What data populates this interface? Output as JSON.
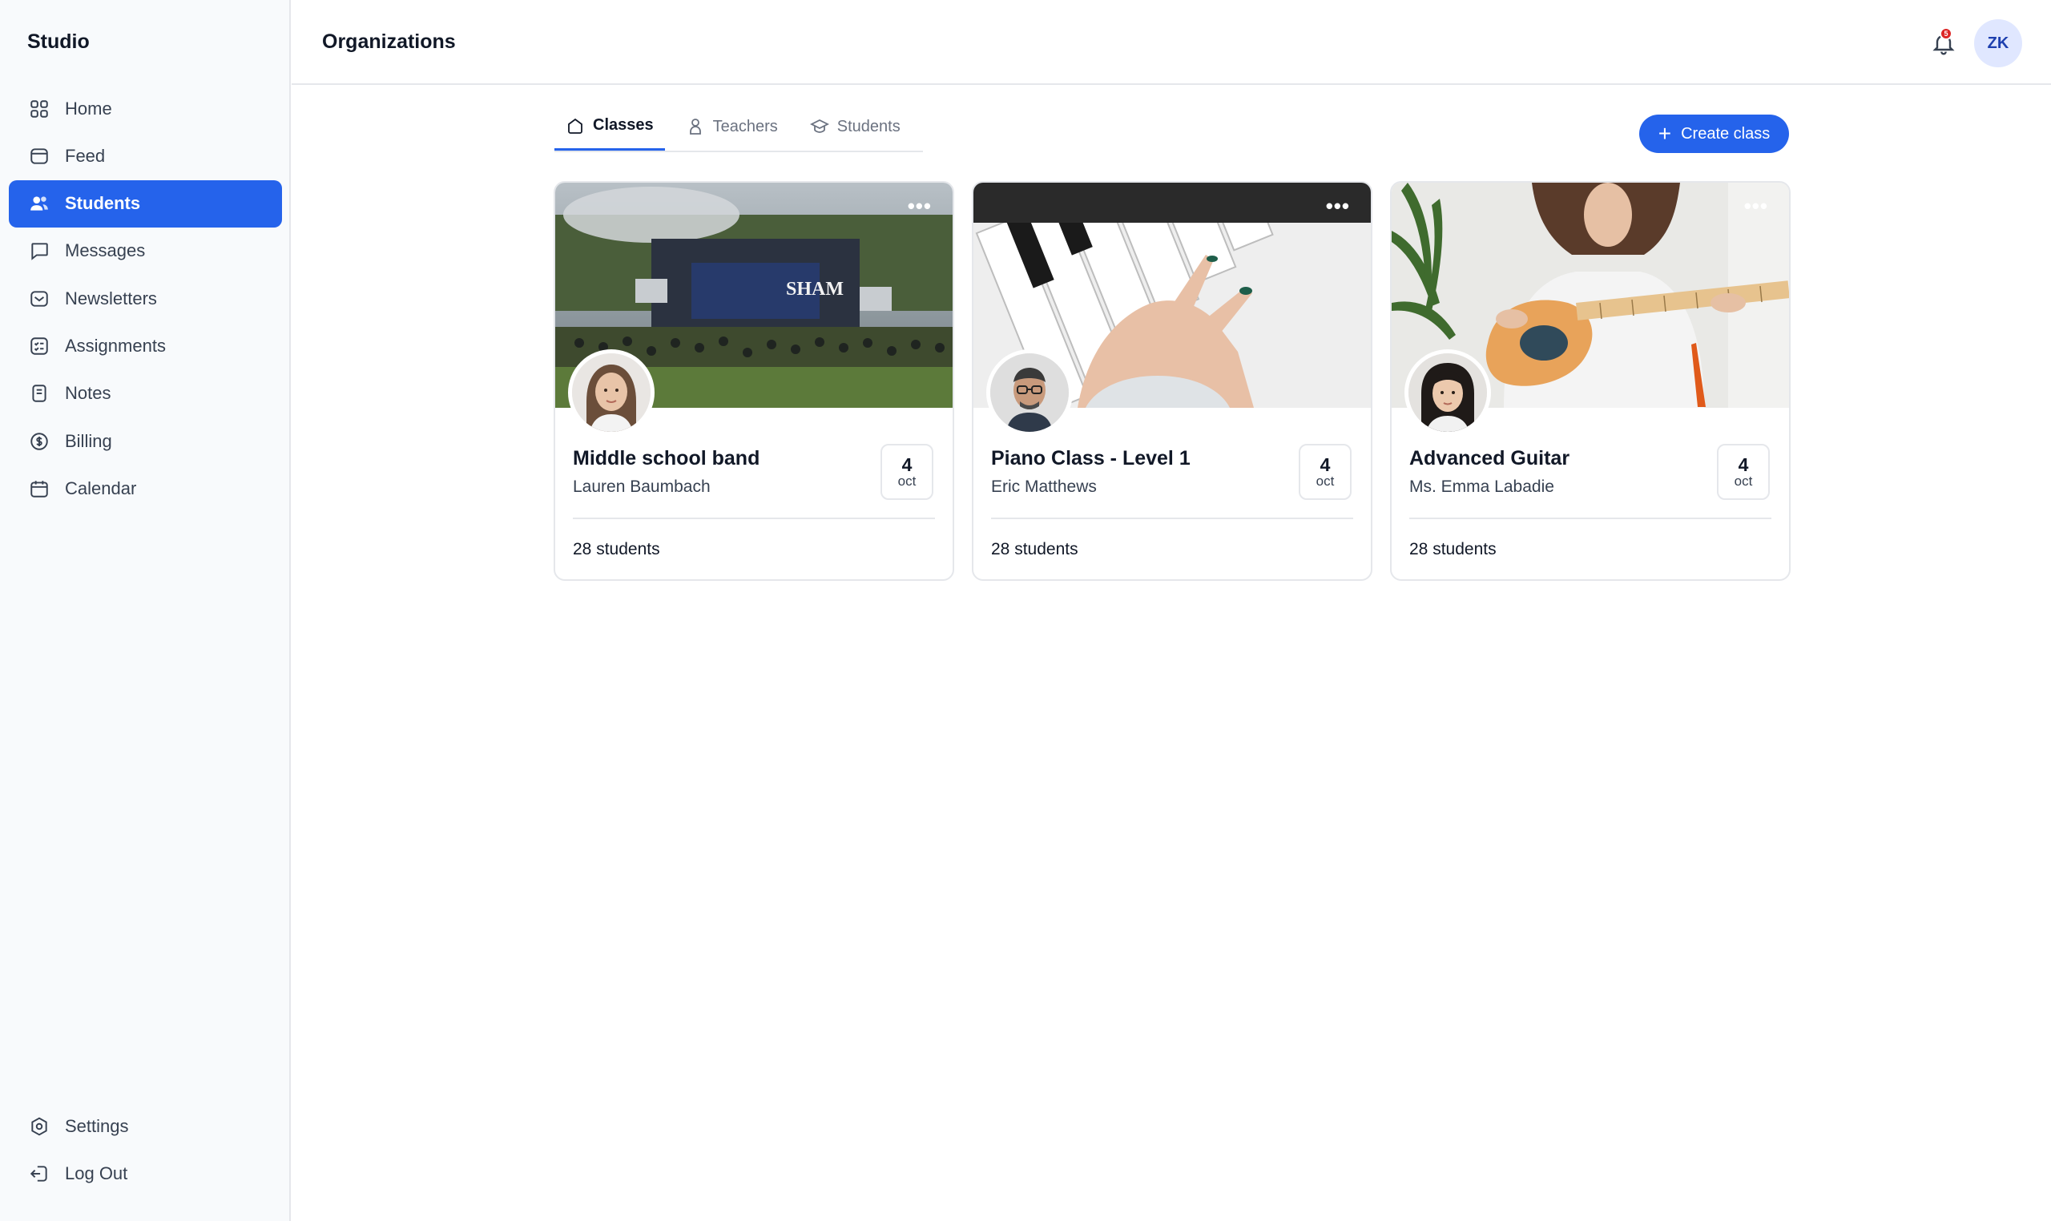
{
  "app": {
    "name": "Studio"
  },
  "sidebar": {
    "items": [
      {
        "label": "Home",
        "icon": "grid-icon"
      },
      {
        "label": "Feed",
        "icon": "feed-icon"
      },
      {
        "label": "Students",
        "icon": "users-icon",
        "active": true
      },
      {
        "label": "Messages",
        "icon": "chat-icon"
      },
      {
        "label": "Newsletters",
        "icon": "mail-icon"
      },
      {
        "label": "Assignments",
        "icon": "checklist-icon"
      },
      {
        "label": "Notes",
        "icon": "notes-icon"
      },
      {
        "label": "Billing",
        "icon": "billing-icon"
      },
      {
        "label": "Calendar",
        "icon": "calendar-icon"
      }
    ],
    "bottom": [
      {
        "label": "Settings",
        "icon": "settings-icon"
      },
      {
        "label": "Log Out",
        "icon": "logout-icon"
      }
    ]
  },
  "header": {
    "title": "Organizations",
    "notification_count": "5",
    "user_initials": "ZK"
  },
  "tabs": [
    {
      "label": "Classes",
      "icon": "home-icon",
      "active": true
    },
    {
      "label": "Teachers",
      "icon": "person-icon"
    },
    {
      "label": "Students",
      "icon": "graduation-cap-icon"
    }
  ],
  "actions": {
    "create_label": "Create class"
  },
  "colors": {
    "accent": "#2563eb",
    "badge": "#dc2626"
  },
  "classes": [
    {
      "title": "Middle school band",
      "teacher": "Lauren Baumbach",
      "day": "4",
      "month": "oct",
      "students": "28 students"
    },
    {
      "title": "Piano Class - Level 1",
      "teacher": "Eric Matthews",
      "day": "4",
      "month": "oct",
      "students": "28 students"
    },
    {
      "title": "Advanced Guitar",
      "teacher": "Ms. Emma Labadie",
      "day": "4",
      "month": "oct",
      "students": "28 students"
    }
  ]
}
